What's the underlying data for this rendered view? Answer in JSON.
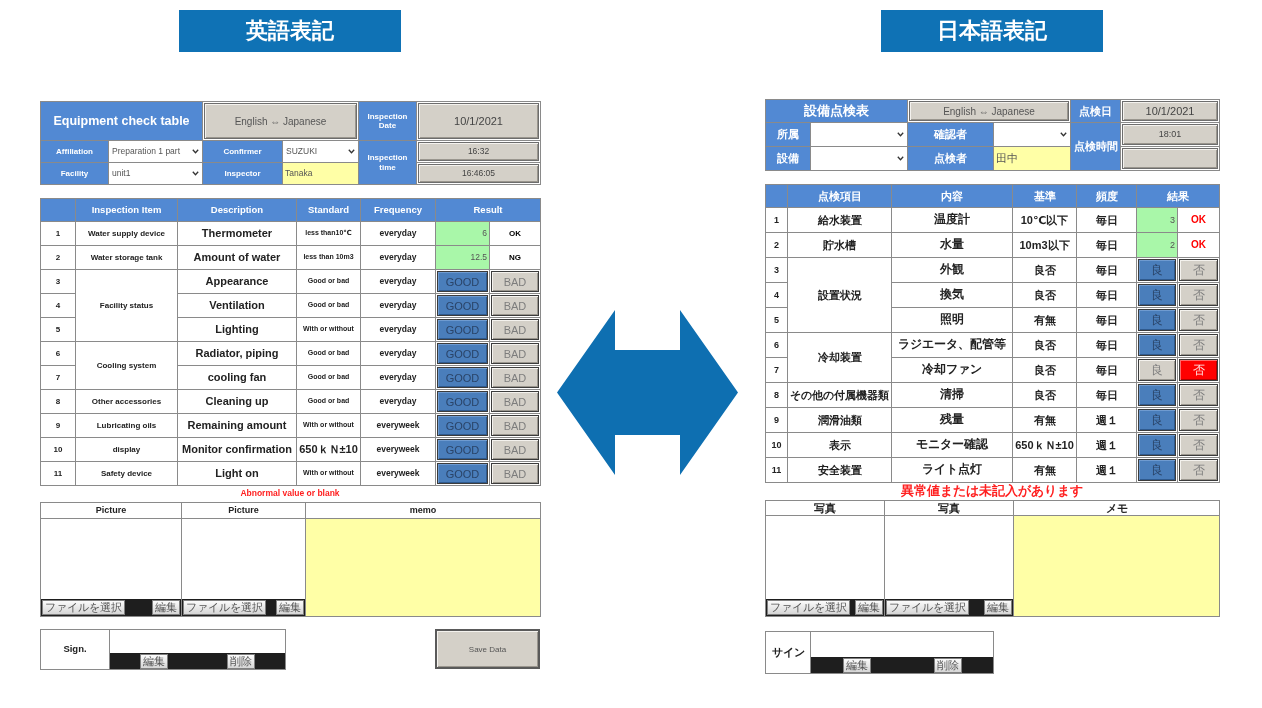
{
  "panels": [
    {
      "banner": "英語表記",
      "header": {
        "title": "Equipment check table",
        "language_toggle": "English ⇔ Japanese",
        "date_label": "Inspection Date",
        "date_value": "10/1/2021",
        "fields": [
          {
            "label": "Affiliation",
            "kind": "select",
            "value": "Preparation 1 part"
          },
          {
            "label": "Confirmer",
            "kind": "select",
            "value": "SUZUKI"
          },
          {
            "label": "Facility",
            "kind": "select",
            "value": "unit1"
          },
          {
            "label": "Inspector",
            "kind": "text",
            "value": "Tanaka"
          }
        ],
        "time_label": "Inspection time",
        "time_values": [
          "16:32",
          "16:46:05"
        ]
      },
      "table": {
        "columns": [
          "Inspection Item",
          "Description",
          "Standard",
          "Frequency",
          "Result"
        ],
        "groups": [
          {
            "item": "Water supply device",
            "rows": [
              {
                "no": "1",
                "description": "Thermometer",
                "standard": "less than10℃",
                "frequency": "everyday",
                "result": {
                  "kind": "measure",
                  "value": "6",
                  "judgment": "OK",
                  "highlighted": false
                }
              }
            ]
          },
          {
            "item": "Water storage tank",
            "rows": [
              {
                "no": "2",
                "description": "Amount of water",
                "standard": "less than 10m3",
                "frequency": "everyday",
                "result": {
                  "kind": "measure",
                  "value": "12.5",
                  "judgment": "NG",
                  "highlighted": false
                }
              }
            ]
          },
          {
            "item": "Facility status",
            "rows": [
              {
                "no": "3",
                "description": "Appearance",
                "standard": "Good or bad",
                "frequency": "everyday",
                "result": {
                  "kind": "choice",
                  "options": [
                    {
                      "kind": "good",
                      "label": "GOOD",
                      "selected": true
                    },
                    {
                      "kind": "bad",
                      "label": "BAD",
                      "selected": false
                    }
                  ]
                }
              },
              {
                "no": "4",
                "description": "Ventilation",
                "standard": "Good or bad",
                "frequency": "everyday",
                "result": {
                  "kind": "choice",
                  "options": [
                    {
                      "kind": "good",
                      "label": "GOOD",
                      "selected": true
                    },
                    {
                      "kind": "bad",
                      "label": "BAD",
                      "selected": false
                    }
                  ]
                }
              },
              {
                "no": "5",
                "description": "Lighting",
                "standard": "With or without",
                "frequency": "everyday",
                "result": {
                  "kind": "choice",
                  "options": [
                    {
                      "kind": "good",
                      "label": "GOOD",
                      "selected": true
                    },
                    {
                      "kind": "bad",
                      "label": "BAD",
                      "selected": false
                    }
                  ]
                }
              }
            ]
          },
          {
            "item": "Cooling system",
            "rows": [
              {
                "no": "6",
                "description": "Radiator, piping",
                "standard": "Good or bad",
                "frequency": "everyday",
                "result": {
                  "kind": "choice",
                  "options": [
                    {
                      "kind": "good",
                      "label": "GOOD",
                      "selected": true
                    },
                    {
                      "kind": "bad",
                      "label": "BAD",
                      "selected": false
                    }
                  ]
                }
              },
              {
                "no": "7",
                "description": "cooling fan",
                "standard": "Good or bad",
                "frequency": "everyday",
                "result": {
                  "kind": "choice",
                  "options": [
                    {
                      "kind": "good",
                      "label": "GOOD",
                      "selected": true
                    },
                    {
                      "kind": "bad",
                      "label": "BAD",
                      "selected": false
                    }
                  ]
                }
              }
            ]
          },
          {
            "item": "Other accessories",
            "rows": [
              {
                "no": "8",
                "description": "Cleaning up",
                "standard": "Good or bad",
                "frequency": "everyday",
                "result": {
                  "kind": "choice",
                  "options": [
                    {
                      "kind": "good",
                      "label": "GOOD",
                      "selected": true
                    },
                    {
                      "kind": "bad",
                      "label": "BAD",
                      "selected": false
                    }
                  ]
                }
              }
            ]
          },
          {
            "item": "Lubricating oils",
            "rows": [
              {
                "no": "9",
                "description": "Remaining amount",
                "standard": "With or without",
                "frequency": "everyweek",
                "result": {
                  "kind": "choice",
                  "options": [
                    {
                      "kind": "good",
                      "label": "GOOD",
                      "selected": true
                    },
                    {
                      "kind": "bad",
                      "label": "BAD",
                      "selected": false
                    }
                  ]
                }
              }
            ]
          },
          {
            "item": "display",
            "rows": [
              {
                "no": "10",
                "description": "Monitor confirmation",
                "standard": "650ｋＮ±10",
                "frequency": "everyweek",
                "result": {
                  "kind": "choice",
                  "options": [
                    {
                      "kind": "good",
                      "label": "GOOD",
                      "selected": true
                    },
                    {
                      "kind": "bad",
                      "label": "BAD",
                      "selected": false
                    }
                  ]
                }
              }
            ]
          },
          {
            "item": "Safety device",
            "rows": [
              {
                "no": "11",
                "description": "Light on",
                "standard": "With or without",
                "frequency": "everyweek",
                "result": {
                  "kind": "choice",
                  "options": [
                    {
                      "kind": "good",
                      "label": "GOOD",
                      "selected": true
                    },
                    {
                      "kind": "bad",
                      "label": "BAD",
                      "selected": false
                    }
                  ]
                }
              }
            ]
          }
        ]
      },
      "notice": "Abnormal value or blank",
      "attachments": [
        {
          "kind": "picture",
          "label": "Picture",
          "file_button": "ファイルを選択",
          "edit_button": "編集"
        },
        {
          "kind": "picture",
          "label": "Picture",
          "file_button": "ファイルを選択",
          "edit_button": "編集"
        },
        {
          "kind": "memo",
          "label": "memo"
        }
      ],
      "sign": {
        "label": "Sign.",
        "buttons": [
          "編集",
          "削除"
        ]
      },
      "save_button": "Save Data"
    },
    {
      "banner": "日本語表記",
      "header": {
        "title": "設備点検表",
        "language_toggle": "English ⇔ Japanese",
        "date_label": "点検日",
        "date_value": "10/1/2021",
        "fields": [
          {
            "label": "所属",
            "kind": "select"
          },
          {
            "label": "確認者",
            "kind": "select"
          },
          {
            "label": "設備",
            "kind": "select"
          },
          {
            "label": "点検者",
            "kind": "text",
            "value": "田中"
          }
        ],
        "time_label": "点検時間",
        "time_values": [
          "18:01"
        ]
      },
      "table": {
        "columns": [
          "点検項目",
          "内容",
          "基準",
          "頻度",
          "結果"
        ],
        "groups": [
          {
            "item": "給水装置",
            "rows": [
              {
                "no": "1",
                "description": "温度計",
                "standard": "10℃以下",
                "frequency": "毎日",
                "result": {
                  "kind": "measure",
                  "value": "3",
                  "judgment": "OK",
                  "highlighted": true
                }
              }
            ]
          },
          {
            "item": "貯水槽",
            "rows": [
              {
                "no": "2",
                "description": "水量",
                "standard": "10m3以下",
                "frequency": "毎日",
                "result": {
                  "kind": "measure",
                  "value": "2",
                  "judgment": "OK",
                  "highlighted": true
                }
              }
            ]
          },
          {
            "item": "設置状況",
            "rows": [
              {
                "no": "3",
                "description": "外観",
                "standard": "良否",
                "frequency": "毎日",
                "result": {
                  "kind": "choice",
                  "options": [
                    {
                      "kind": "good",
                      "label": "良",
                      "selected": true
                    },
                    {
                      "kind": "bad",
                      "label": "否",
                      "selected": false
                    }
                  ]
                }
              },
              {
                "no": "4",
                "description": "換気",
                "standard": "良否",
                "frequency": "毎日",
                "result": {
                  "kind": "choice",
                  "options": [
                    {
                      "kind": "good",
                      "label": "良",
                      "selected": true
                    },
                    {
                      "kind": "bad",
                      "label": "否",
                      "selected": false
                    }
                  ]
                }
              },
              {
                "no": "5",
                "description": "照明",
                "standard": "有無",
                "frequency": "毎日",
                "result": {
                  "kind": "choice",
                  "options": [
                    {
                      "kind": "good",
                      "label": "良",
                      "selected": true
                    },
                    {
                      "kind": "bad",
                      "label": "否",
                      "selected": false
                    }
                  ]
                }
              }
            ]
          },
          {
            "item": "冷却装置",
            "rows": [
              {
                "no": "6",
                "description": "ラジエータ、配管等",
                "standard": "良否",
                "frequency": "毎日",
                "result": {
                  "kind": "choice",
                  "options": [
                    {
                      "kind": "good",
                      "label": "良",
                      "selected": true
                    },
                    {
                      "kind": "bad",
                      "label": "否",
                      "selected": false
                    }
                  ]
                }
              },
              {
                "no": "7",
                "description": "冷却ファン",
                "standard": "良否",
                "frequency": "毎日",
                "result": {
                  "kind": "choice",
                  "options": [
                    {
                      "kind": "good",
                      "label": "良",
                      "selected": false
                    },
                    {
                      "kind": "bad",
                      "label": "否",
                      "selected": true
                    }
                  ]
                }
              }
            ]
          },
          {
            "item": "その他の付属機器類",
            "rows": [
              {
                "no": "8",
                "description": "清掃",
                "standard": "良否",
                "frequency": "毎日",
                "result": {
                  "kind": "choice",
                  "options": [
                    {
                      "kind": "good",
                      "label": "良",
                      "selected": true
                    },
                    {
                      "kind": "bad",
                      "label": "否",
                      "selected": false
                    }
                  ]
                }
              }
            ]
          },
          {
            "item": "潤滑油類",
            "rows": [
              {
                "no": "9",
                "description": "残量",
                "standard": "有無",
                "frequency": "週１",
                "result": {
                  "kind": "choice",
                  "options": [
                    {
                      "kind": "good",
                      "label": "良",
                      "selected": true
                    },
                    {
                      "kind": "bad",
                      "label": "否",
                      "selected": false
                    }
                  ]
                }
              }
            ]
          },
          {
            "item": "表示",
            "rows": [
              {
                "no": "10",
                "description": "モニター確認",
                "standard": "650ｋＮ±10",
                "frequency": "週１",
                "result": {
                  "kind": "choice",
                  "options": [
                    {
                      "kind": "good",
                      "label": "良",
                      "selected": true
                    },
                    {
                      "kind": "bad",
                      "label": "否",
                      "selected": false
                    }
                  ]
                }
              }
            ]
          },
          {
            "item": "安全装置",
            "rows": [
              {
                "no": "11",
                "description": "ライト点灯",
                "standard": "有無",
                "frequency": "週１",
                "result": {
                  "kind": "choice",
                  "options": [
                    {
                      "kind": "good",
                      "label": "良",
                      "selected": true
                    },
                    {
                      "kind": "bad",
                      "label": "否",
                      "selected": false
                    }
                  ]
                }
              }
            ]
          }
        ]
      },
      "notice": "異常値または未記入があります",
      "attachments": [
        {
          "kind": "picture",
          "label": "写真",
          "file_button": "ファイルを選択",
          "edit_button": "編集"
        },
        {
          "kind": "picture",
          "label": "写真",
          "file_button": "ファイルを選択",
          "edit_button": "編集"
        },
        {
          "kind": "memo",
          "label": "メモ"
        }
      ],
      "sign": {
        "label": "サイン",
        "buttons": [
          "編集",
          "削除"
        ]
      }
    }
  ]
}
